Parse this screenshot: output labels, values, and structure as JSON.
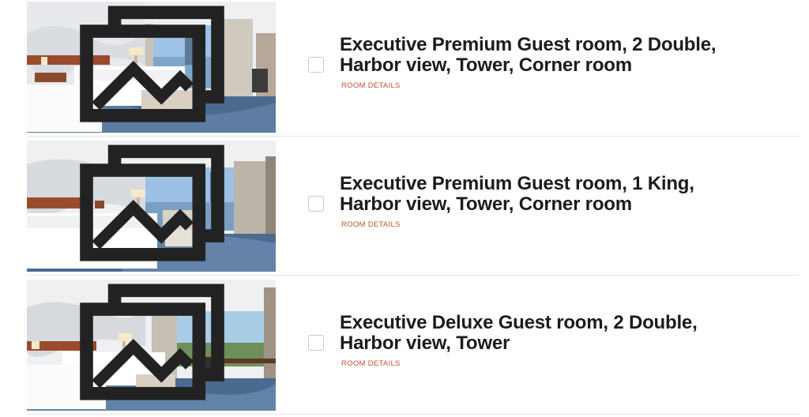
{
  "rooms": [
    {
      "title_line1": "Executive Premium Guest room, 2 Double,",
      "title_line2": "Harbor view, Tower, Corner room",
      "details_label": "ROOM DETAILS"
    },
    {
      "title_line1": "Executive Premium Guest room, 1 King,",
      "title_line2": "Harbor view, Tower, Corner room",
      "details_label": "ROOM DETAILS"
    },
    {
      "title_line1": "Executive Deluxe Guest room, 2 Double,",
      "title_line2": "Harbor view, Tower",
      "details_label": "ROOM DETAILS"
    }
  ],
  "icons": {
    "gallery": "gallery-icon"
  },
  "colors": {
    "details_link": "#c0512f",
    "title": "#1c1c1c"
  }
}
